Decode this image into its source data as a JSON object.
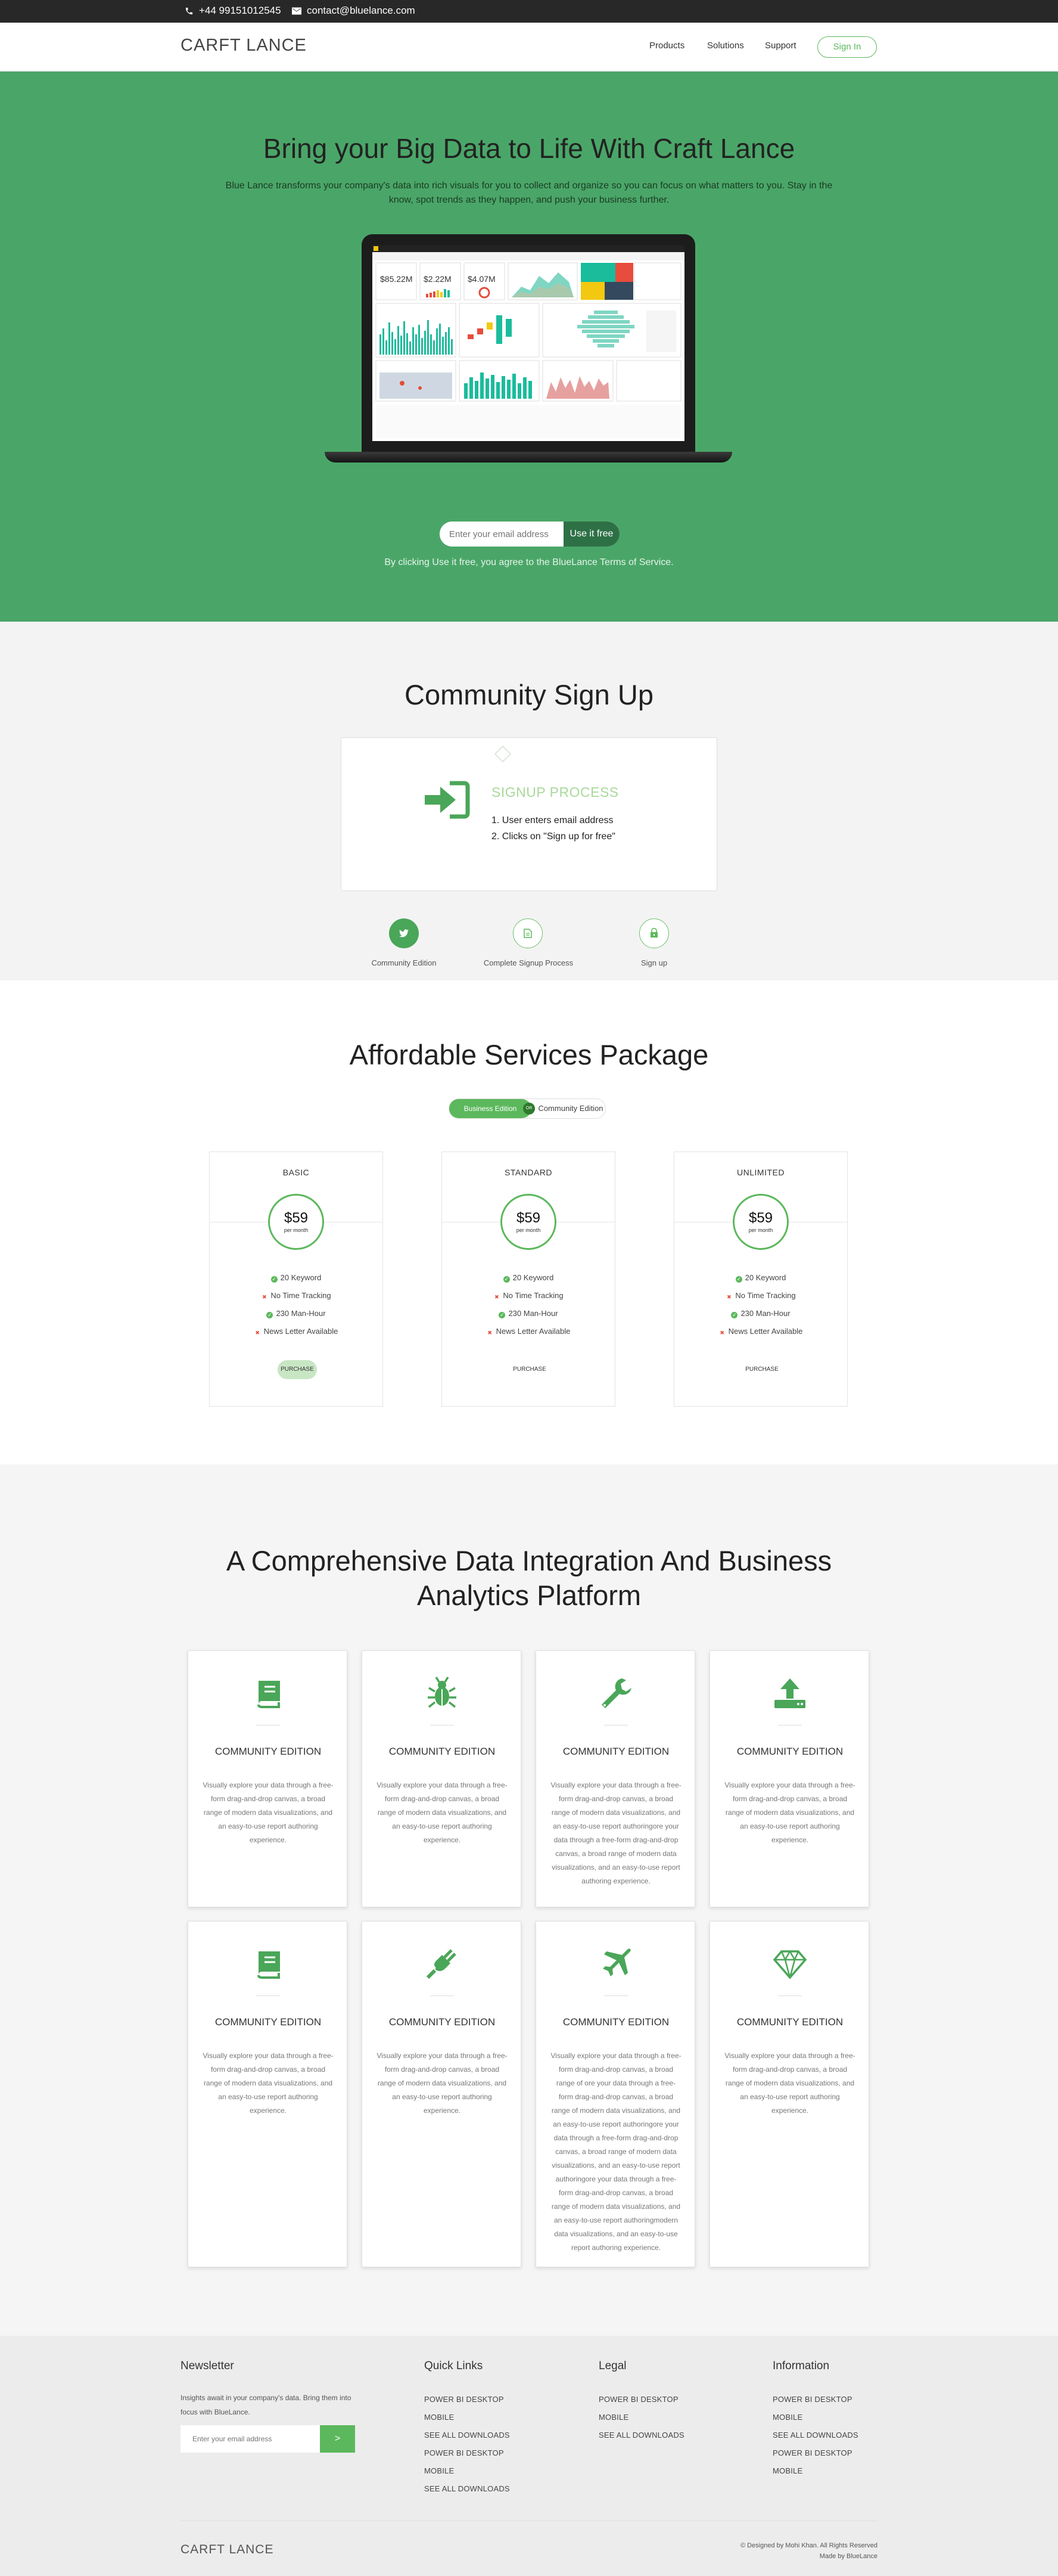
{
  "topbar": {
    "phone": "+44 99151012545",
    "email": "contact@bluelance.com"
  },
  "nav": {
    "logo": "CARFT LANCE",
    "links": [
      "Products",
      "Solutions",
      "Support"
    ],
    "signin": "Sign In"
  },
  "hero": {
    "title": "Bring your Big Data to Life With Craft Lance",
    "subtitle": "Blue Lance transforms your company's data into rich visuals for you to collect and organize so you can focus on what matters to you. Stay in the know, spot trends as they happen, and push your business further.",
    "dashboard_kpis": [
      "$85.22M",
      "$2.22M",
      "$4.07M"
    ],
    "email_placeholder": "Enter your email address",
    "cta": "Use it free",
    "terms": "By clicking Use it free, you agree to the BlueLance Terms of Service."
  },
  "community": {
    "title": "Community Sign Up",
    "card_title": "SIGNUP PROCESS",
    "steps": [
      "1. User enters email address",
      "2. Clicks on \"Sign up for free\""
    ],
    "tabs": [
      "Community Edition",
      "Complete Signup Process",
      "Sign up"
    ],
    "tab_icons": [
      "twitter-icon",
      "file-icon",
      "lock-icon"
    ]
  },
  "pricing": {
    "title": "Affordable Services Package",
    "toggle_active": "Business Edition",
    "toggle_badge": "OR",
    "toggle_inactive": "Community Edition",
    "plans": [
      {
        "name": "BASIC",
        "price": "$59",
        "per": "per month",
        "button": "PURCHASE"
      },
      {
        "name": "STANDARD",
        "price": "$59",
        "per": "per month",
        "button": "PURCHASE"
      },
      {
        "name": "UNLIMITED",
        "price": "$59",
        "per": "per month",
        "button": "PURCHASE"
      }
    ],
    "features": [
      {
        "label": "20 Keyword",
        "included": true
      },
      {
        "label": "No Time Tracking",
        "included": false
      },
      {
        "label": "230 Man-Hour",
        "included": true
      },
      {
        "label": "News Letter Available",
        "included": false
      }
    ],
    "colors": {
      "accent": "#5cb85c",
      "cross": "#e74c3c"
    }
  },
  "platform": {
    "title_line1": "A Comprehensive Data Integration And Business",
    "title_line2": "Analytics Platform",
    "cards": [
      {
        "icon": "book-icon",
        "title": "COMMUNITY EDITION",
        "text": "Visually explore your data through a free-form drag-and-drop canvas, a broad range of modern data visualizations, and an easy-to-use report authoring experience."
      },
      {
        "icon": "bug-icon",
        "title": "COMMUNITY EDITION",
        "text": "Visually explore your data through a free-form drag-and-drop canvas, a broad range of modern data visualizations, and an easy-to-use report authoring experience."
      },
      {
        "icon": "wrench-icon",
        "title": "COMMUNITY EDITION",
        "text": "Visually explore your data through a free-form drag-and-drop canvas, a broad range of modern data visualizations, and an easy-to-use report authoringore your data through a free-form drag-and-drop canvas, a broad range of modern data visualizations, and an easy-to-use report authoring experience."
      },
      {
        "icon": "upload-icon",
        "title": "COMMUNITY EDITION",
        "text": "Visually explore your data through a free-form drag-and-drop canvas, a broad range of modern data visualizations, and an easy-to-use report authoring experience."
      },
      {
        "icon": "book-icon",
        "title": "COMMUNITY EDITION",
        "text": "Visually explore your data through a free-form drag-and-drop canvas, a broad range of modern data visualizations, and an easy-to-use report authoring experience."
      },
      {
        "icon": "plug-icon",
        "title": "COMMUNITY EDITION",
        "text": "Visually explore your data through a free-form drag-and-drop canvas, a broad range of modern data visualizations, and an easy-to-use report authoring experience."
      },
      {
        "icon": "plane-icon",
        "title": "COMMUNITY EDITION",
        "text": "Visually explore your data through a free-form drag-and-drop canvas, a broad range of ore your data through a free-form drag-and-drop canvas, a broad range of modern data visualizations, and an easy-to-use report authoringore your data through a free-form drag-and-drop canvas, a broad range of modern data visualizations, and an easy-to-use report authoringore your data through a free-form drag-and-drop canvas, a broad range of modern data visualizations, and an easy-to-use report authoringmodern data visualizations, and an easy-to-use report authoring experience."
      },
      {
        "icon": "diamond-icon",
        "title": "COMMUNITY EDITION",
        "text": "Visually explore your data through a free-form drag-and-drop canvas, a broad range of modern data visualizations, and an easy-to-use report authoring experience."
      }
    ]
  },
  "footer": {
    "newsletter_title": "Newsletter",
    "newsletter_text": "Insights await in your company's data. Bring them into focus with BlueLance.",
    "newsletter_placeholder": "Enter your email address",
    "newsletter_button": ">",
    "quick_links_title": "Quick Links",
    "quick_links": [
      "POWER BI DESKTOP",
      "MOBILE",
      "SEE ALL DOWNLOADS",
      "POWER BI DESKTOP",
      "MOBILE",
      "SEE ALL DOWNLOADS"
    ],
    "legal_title": "Legal",
    "legal": [
      "POWER BI DESKTOP",
      "MOBILE",
      "SEE ALL DOWNLOADS"
    ],
    "information_title": "Information",
    "information": [
      "POWER BI DESKTOP",
      "MOBILE",
      "SEE ALL DOWNLOADS",
      "POWER BI DESKTOP",
      "MOBILE"
    ],
    "logo": "CARFT LANCE",
    "copyright": "© Designed by Mohi Khan. All Rights Reserved",
    "made_by": "Made by BlueLance"
  }
}
